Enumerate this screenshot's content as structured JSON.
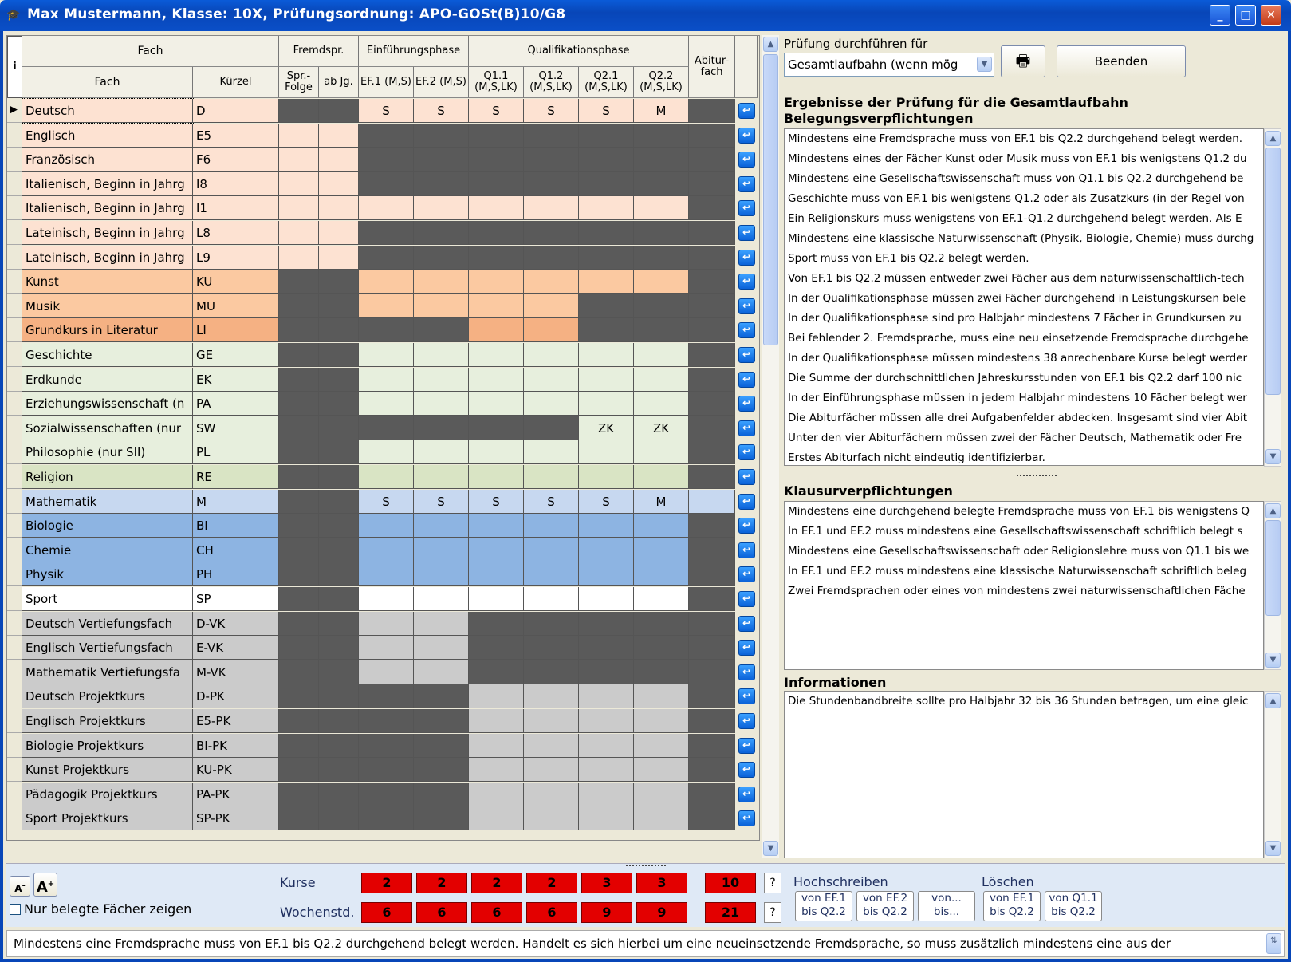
{
  "window": {
    "title": "Max Mustermann, Klasse: 10X, Prüfungsordnung: APO-GOSt(B)10/G8",
    "minimize": "_",
    "maximize": "□",
    "close": "✕"
  },
  "grid_header": {
    "info": "i",
    "fach_group": "Fach",
    "fremdspr": "Fremdspr.",
    "einf": "Einführungsphase",
    "qual": "Qualifikationsphase",
    "abitur": "Abitur-fach",
    "fach": "Fach",
    "kuerzel": "Kürzel",
    "spr_folge": "Spr.-Folge",
    "ab_jg": "ab Jg.",
    "ef1": "EF.1 (M,S)",
    "ef2": "EF.2 (M,S)",
    "q11": "Q1.1 (M,S,LK)",
    "q12": "Q1.2 (M,S,LK)",
    "q21": "Q2.1 (M,S,LK)",
    "q22": "Q2.2 (M,S,LK)"
  },
  "colors": {
    "light_orange": "#fde2d2",
    "orange": "#fbc9a1",
    "dark_orange": "#f5b183",
    "light_green": "#e7efdd",
    "olive": "#d9e4c4",
    "light_blue": "#c7d8f0",
    "blue": "#8db4e2",
    "white": "#ffffff",
    "grey": "#cbcbcb",
    "dark": "#666666",
    "darker": "#5a5a5a"
  },
  "rows": [
    {
      "fach": "Deutsch",
      "kz": "D",
      "bg": "light_orange",
      "mask": "dd111111d",
      "vals": [
        "",
        "",
        "S",
        "S",
        "S",
        "S",
        "S",
        "M",
        ""
      ],
      "selected": true
    },
    {
      "fach": "Englisch",
      "kz": "E5",
      "bg": "light_orange",
      "mask": "11dddddd d",
      "vals": [
        "",
        "",
        "",
        "",
        "",
        "",
        "",
        "",
        ""
      ]
    },
    {
      "fach": "Französisch",
      "kz": "F6",
      "bg": "light_orange",
      "mask": "11dddddd d",
      "vals": [
        "",
        "",
        "",
        "",
        "",
        "",
        "",
        "",
        ""
      ]
    },
    {
      "fach": "Italienisch, Beginn in Jahrg",
      "kz": "I8",
      "bg": "light_orange",
      "mask": "11dddddd d",
      "vals": [
        "",
        "",
        "",
        "",
        "",
        "",
        "",
        "",
        ""
      ]
    },
    {
      "fach": "Italienisch, Beginn in Jahrg",
      "kz": "I1",
      "bg": "light_orange",
      "mask": "11111111d",
      "vals": [
        "",
        "",
        "",
        "",
        "",
        "",
        "",
        "",
        ""
      ]
    },
    {
      "fach": "Lateinisch, Beginn in Jahrg",
      "kz": "L8",
      "bg": "light_orange",
      "mask": "11dddddd d",
      "vals": [
        "",
        "",
        "",
        "",
        "",
        "",
        "",
        "",
        ""
      ]
    },
    {
      "fach": "Lateinisch, Beginn in Jahrg",
      "kz": "L9",
      "bg": "light_orange",
      "mask": "11dddddd d",
      "vals": [
        "",
        "",
        "",
        "",
        "",
        "",
        "",
        "",
        ""
      ]
    },
    {
      "fach": "Kunst",
      "kz": "KU",
      "bg": "orange",
      "mask": "dd111111d",
      "vals": [
        "",
        "",
        "",
        "",
        "",
        "",
        "",
        "",
        ""
      ]
    },
    {
      "fach": "Musik",
      "kz": "MU",
      "bg": "orange",
      "mask": "dd1111ddd",
      "vals": [
        "",
        "",
        "",
        "",
        "",
        "",
        "",
        "",
        ""
      ]
    },
    {
      "fach": "Grundkurs in Literatur",
      "kz": "LI",
      "bg": "dark_orange",
      "mask": "dddd11ddd",
      "vals": [
        "",
        "",
        "",
        "",
        "",
        "",
        "",
        "",
        ""
      ]
    },
    {
      "fach": "Geschichte",
      "kz": "GE",
      "bg": "light_green",
      "mask": "dd111111d",
      "vals": [
        "",
        "",
        "",
        "",
        "",
        "",
        "",
        "",
        ""
      ]
    },
    {
      "fach": "Erdkunde",
      "kz": "EK",
      "bg": "light_green",
      "mask": "dd111111d",
      "vals": [
        "",
        "",
        "",
        "",
        "",
        "",
        "",
        "",
        ""
      ]
    },
    {
      "fach": "Erziehungswissenschaft (n",
      "kz": "PA",
      "bg": "light_green",
      "mask": "dd111111d",
      "vals": [
        "",
        "",
        "",
        "",
        "",
        "",
        "",
        "",
        ""
      ]
    },
    {
      "fach": "Sozialwissenschaften (nur",
      "kz": "SW",
      "bg": "light_green",
      "mask": "dddddd11d",
      "vals": [
        "",
        "",
        "",
        "",
        "",
        "",
        "ZK",
        "ZK",
        ""
      ]
    },
    {
      "fach": "Philosophie (nur SII)",
      "kz": "PL",
      "bg": "light_green",
      "mask": "dd111111d",
      "vals": [
        "",
        "",
        "",
        "",
        "",
        "",
        "",
        "",
        ""
      ]
    },
    {
      "fach": "Religion",
      "kz": "RE",
      "bg": "olive",
      "mask": "dd111111d",
      "vals": [
        "",
        "",
        "",
        "",
        "",
        "",
        "",
        "",
        ""
      ]
    },
    {
      "fach": "Mathematik",
      "kz": "M",
      "bg": "light_blue",
      "mask": "dd1111111",
      "vals": [
        "",
        "",
        "S",
        "S",
        "S",
        "S",
        "S",
        "M",
        ""
      ]
    },
    {
      "fach": "Biologie",
      "kz": "BI",
      "bg": "blue",
      "mask": "dd111111d",
      "vals": [
        "",
        "",
        "",
        "",
        "",
        "",
        "",
        "",
        ""
      ]
    },
    {
      "fach": "Chemie",
      "kz": "CH",
      "bg": "blue",
      "mask": "dd111111d",
      "vals": [
        "",
        "",
        "",
        "",
        "",
        "",
        "",
        "",
        ""
      ]
    },
    {
      "fach": "Physik",
      "kz": "PH",
      "bg": "blue",
      "mask": "dd111111d",
      "vals": [
        "",
        "",
        "",
        "",
        "",
        "",
        "",
        "",
        ""
      ]
    },
    {
      "fach": "Sport",
      "kz": "SP",
      "bg": "white",
      "mask": "dd111111d",
      "vals": [
        "",
        "",
        "",
        "",
        "",
        "",
        "",
        "",
        ""
      ]
    },
    {
      "fach": "Deutsch Vertiefungsfach",
      "kz": "D-VK",
      "bg": "grey",
      "mask": "dd11dddd d",
      "vals": [
        "",
        "",
        "",
        "",
        "",
        "",
        "",
        "",
        ""
      ]
    },
    {
      "fach": "Englisch Vertiefungsfach",
      "kz": "E-VK",
      "bg": "grey",
      "mask": "dd11dddd d",
      "vals": [
        "",
        "",
        "",
        "",
        "",
        "",
        "",
        "",
        ""
      ]
    },
    {
      "fach": "Mathematik Vertiefungsfa",
      "kz": "M-VK",
      "bg": "grey",
      "mask": "dd11dddd d",
      "vals": [
        "",
        "",
        "",
        "",
        "",
        "",
        "",
        "",
        ""
      ]
    },
    {
      "fach": "Deutsch Projektkurs",
      "kz": "D-PK",
      "bg": "grey",
      "mask": "dddd1111d",
      "vals": [
        "",
        "",
        "",
        "",
        "",
        "",
        "",
        "",
        ""
      ]
    },
    {
      "fach": "Englisch Projektkurs",
      "kz": "E5-PK",
      "bg": "grey",
      "mask": "dddd1111d",
      "vals": [
        "",
        "",
        "",
        "",
        "",
        "",
        "",
        "",
        ""
      ]
    },
    {
      "fach": "Biologie Projektkurs",
      "kz": "BI-PK",
      "bg": "grey",
      "mask": "dddd1111d",
      "vals": [
        "",
        "",
        "",
        "",
        "",
        "",
        "",
        "",
        ""
      ]
    },
    {
      "fach": "Kunst Projektkurs",
      "kz": "KU-PK",
      "bg": "grey",
      "mask": "dddd1111d",
      "vals": [
        "",
        "",
        "",
        "",
        "",
        "",
        "",
        "",
        ""
      ]
    },
    {
      "fach": "Pädagogik Projektkurs",
      "kz": "PA-PK",
      "bg": "grey",
      "mask": "dddd1111d",
      "vals": [
        "",
        "",
        "",
        "",
        "",
        "",
        "",
        "",
        ""
      ]
    },
    {
      "fach": "Sport Projektkurs",
      "kz": "SP-PK",
      "bg": "grey",
      "mask": "dddd1111d",
      "vals": [
        "",
        "",
        "",
        "",
        "",
        "",
        "",
        "",
        ""
      ]
    }
  ],
  "right": {
    "pruefung_label": "Prüfung durchführen für",
    "pruefung_value": "Gesamtlaufbahn (wenn mög",
    "beenden": "Beenden",
    "ergebnis_title": "Ergebnisse der Prüfung für die Gesamtlaufbahn",
    "beleg_title": "Belegungsverpflichtungen",
    "beleg": [
      "Mindestens eine Fremdsprache muss von EF.1 bis Q2.2 durchgehend belegt werden.",
      "Mindestens eines der Fächer Kunst oder Musik muss von EF.1 bis wenigstens Q1.2 du",
      "Mindestens eine Gesellschaftswissenschaft muss von Q1.1 bis Q2.2 durchgehend be",
      "Geschichte muss von EF.1 bis wenigstens Q1.2 oder als Zusatzkurs (in der Regel von",
      "Ein Religionskurs muss wenigstens von EF.1-Q1.2 durchgehend belegt werden. Als E",
      "Mindestens eine klassische Naturwissenschaft (Physik, Biologie, Chemie) muss durchg",
      "Sport muss von EF.1 bis Q2.2 belegt werden.",
      "Von EF.1 bis Q2.2 müssen entweder zwei Fächer aus dem naturwissenschaftlich-tech",
      "In der Qualifikationsphase müssen zwei Fächer durchgehend in Leistungskursen bele",
      "In der Qualifikationsphase sind pro Halbjahr mindestens 7 Fächer in Grundkursen zu",
      "Bei fehlender 2. Fremdsprache, muss eine neu einsetzende Fremdsprache durchgehe",
      "In der Qualifikationsphase müssen mindestens 38 anrechenbare Kurse belegt werder",
      "Die Summe der durchschnittlichen Jahreskursstunden von EF.1 bis Q2.2 darf 100 nic",
      "In der Einführungsphase müssen in jedem Halbjahr mindestens 10 Fächer belegt wer",
      "Die Abiturfächer müssen alle drei Aufgabenfelder abdecken. Insgesamt sind vier Abit",
      "Unter den vier Abiturfächern müssen zwei der Fächer Deutsch, Mathematik oder Fre",
      "Erstes Abiturfach nicht eindeutig identifizierbar."
    ],
    "klausur_title": "Klausurverpflichtungen",
    "klausur": [
      "Mindestens eine durchgehend belegte Fremdsprache muss von EF.1 bis wenigstens Q",
      "In EF.1 und EF.2 muss mindestens eine Gesellschaftswissenschaft schriftlich belegt s",
      "Mindestens eine Gesellschaftswissenschaft oder Religionslehre muss von Q1.1 bis we",
      "In EF.1 und EF.2 muss mindestens eine klassische Naturwissenschaft schriftlich beleg",
      "Zwei Fremdsprachen oder eines von mindestens zwei naturwissenschaftlichen Fäche"
    ],
    "info_title": "Informationen",
    "info": [
      "Die Stundenbandbreite sollte pro Halbjahr 32 bis 36 Stunden betragen, um eine gleic"
    ]
  },
  "bottom": {
    "font_small": "A",
    "font_big": "A",
    "nur_belegte": "Nur belegte Fächer zeigen",
    "kurse_label": "Kurse",
    "wochenstd_label": "Wochenstd.",
    "kurse": [
      "2",
      "2",
      "2",
      "2",
      "3",
      "3"
    ],
    "kurse_total": "10",
    "wochenstd": [
      "6",
      "6",
      "6",
      "6",
      "9",
      "9"
    ],
    "wochenstd_total": "21",
    "q": "?",
    "hochschreiben": "Hochschreiben",
    "loeschen": "Löschen",
    "hs_btns": [
      "von EF.1 bis Q2.2",
      "von EF.2 bis Q2.2",
      "von... bis..."
    ],
    "lo_btns": [
      "von EF.1 bis Q2.2",
      "von Q1.1 bis Q2.2"
    ]
  },
  "status_text": "Mindestens eine Fremdsprache muss von EF.1 bis Q2.2 durchgehend belegt werden. Handelt es sich hierbei um eine neueinsetzende Fremdsprache, so muss zusätzlich mindestens  eine aus der"
}
